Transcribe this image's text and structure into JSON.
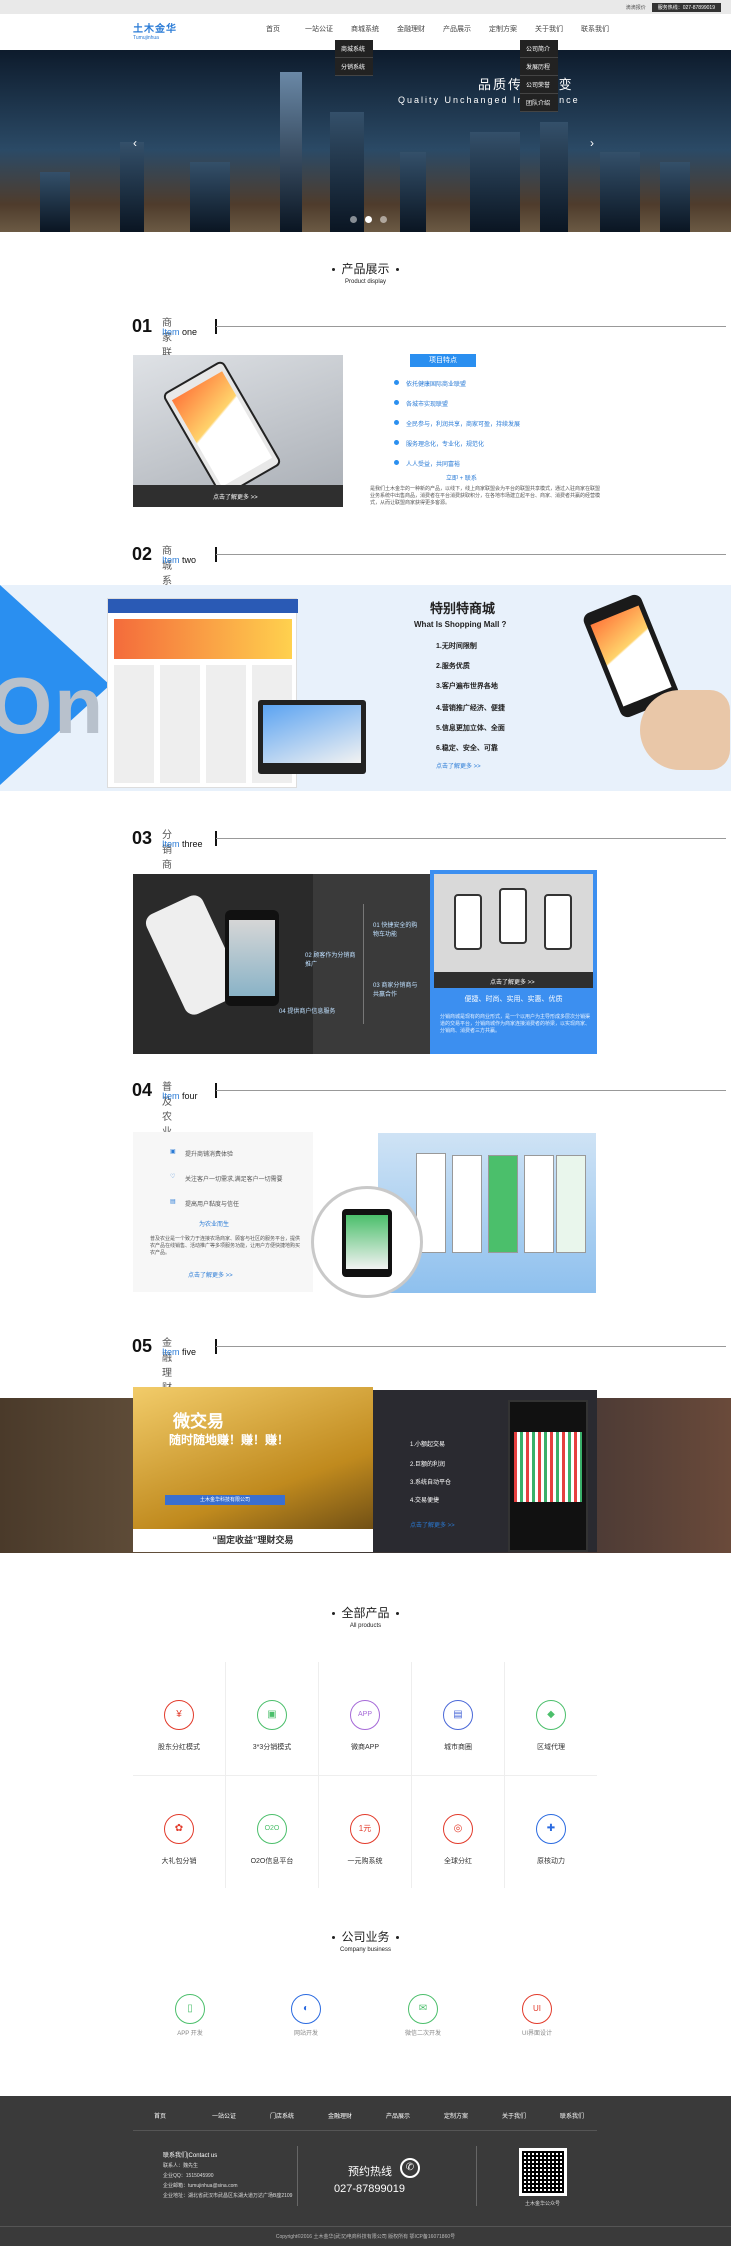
{
  "topbar": {
    "item1": "滴滴报价",
    "tel": "服务热线：027-87899019"
  },
  "header": {
    "logo_cn": "土木金华",
    "logo_en": "Tumujinhua",
    "nav": [
      "首页",
      "一站公证",
      "商城系统",
      "金融理财",
      "产品展示",
      "定制方案",
      "关于我们",
      "联系我们"
    ],
    "sub_mall": [
      "商城系统",
      "分销系统"
    ],
    "sub_about": [
      "公司简介",
      "发展历程",
      "公司荣誉",
      "团队介绍"
    ]
  },
  "hero": {
    "title": "品质传承 蜕变",
    "subtitle": "Quality Unchanged Inheritance",
    "prev": "‹",
    "next": "›"
  },
  "products": {
    "title_cn": "产品展示",
    "title_en": "Product display"
  },
  "item1": {
    "num": "01",
    "cn": "商家联盟",
    "en_a": "Item ",
    "en_b": "one",
    "badge": "项目特点",
    "features": [
      "依托健康国际商业联盟",
      "各城市实现联盟",
      "全民参与，利润共享，商家可盈，持续发展",
      "服务理念化，专业化，规范化",
      "人人受益，共同富裕"
    ],
    "more": "立即 + 联系",
    "cta": "点击了解更多 >>",
    "desc": "是我们土木金华的一种新的产品，以线下，线上商家联盟会为平台的联盟共享模式，通过入驻商家在联盟业务系统中出售商品，消费者在平台消费获取积分，在各地市场建立起平台、商家、消费者共赢的经营模式，从而让联盟商家获得更多客源。"
  },
  "item2": {
    "num": "02",
    "cn": "商城系统",
    "en_a": "Item ",
    "en_b": "two",
    "watermark": "One",
    "title_cn": "特别特商城",
    "title_en": "What Is Shopping Mall ?",
    "points": [
      "1.无时间限制",
      "2.服务优质",
      "3.客户遍布世界各地",
      "4.营销推广经济、便捷",
      "5.信息更加立体、全面",
      "6.稳定、安全、可靠"
    ],
    "cta": "点击了解更多 >>"
  },
  "item3": {
    "num": "03",
    "cn": "分销商城",
    "en_a": "Item ",
    "en_b": "three",
    "points": [
      "01 快捷安全的购物车功能",
      "02 顾客作为分销商推广",
      "03 商家分销商与共赢合作",
      "04 提供商户信息服务"
    ],
    "cta": "点击了解更多 >>",
    "keywords": "便捷、时尚、实用、实惠、优质",
    "desc": "分销商城是现有的商业形式，是一个以用户为主导形成多层次分销渠道的交易平台，分销商城作为商家连接消费者的桥梁，以实现商家、分销商、消费者三方共赢。"
  },
  "item4": {
    "num": "04",
    "cn": "普及农业",
    "en_a": "Item ",
    "en_b": "four",
    "points": [
      "提升商铺消费体验",
      "关注客户一切需求,满足客户一切需要",
      "提高用户黏度与信任"
    ],
    "more": "为农业而生",
    "cta": "点击了解更多 >>",
    "desc": "普及农业是一个致力于连接农场商家、顾客与社区的服务平台，提供农产品在线销售、活动推广等多项服务功能，让用户方便快捷地购买农产品。"
  },
  "item5": {
    "num": "05",
    "cn": "金融理财",
    "en_a": "Item ",
    "en_b": "five",
    "gold_title": "微交易",
    "gold_sub": "随时随地赚！赚！赚！",
    "gold_tag": "土木金华科技有限公司",
    "banner": "“固定收益”理财交易",
    "points": [
      "1.小额起交易",
      "2.巨额的利润",
      "3.系统自动平仓",
      "4.交易便捷"
    ],
    "cta": "点击了解更多 >>"
  },
  "all": {
    "title_cn": "全部产品",
    "title_en": "All products",
    "items": [
      {
        "label": "股东分红模式",
        "icon": "¥",
        "color": "#e23a2a"
      },
      {
        "label": "3*3分销模式",
        "icon": "▣",
        "color": "#4bbf6b"
      },
      {
        "label": "微商APP",
        "icon": "APP",
        "color": "#a66ad8"
      },
      {
        "label": "城市商圈",
        "icon": "▤",
        "color": "#4a68d8"
      },
      {
        "label": "区域代理",
        "icon": "◆",
        "color": "#4bbf6b"
      },
      {
        "label": "大礼包分销",
        "icon": "✿",
        "color": "#e23a2a"
      },
      {
        "label": "O2O信息平台",
        "icon": "O2O",
        "color": "#4bbf6b"
      },
      {
        "label": "一元购系统",
        "icon": "1元",
        "color": "#e23a2a"
      },
      {
        "label": "全球分红",
        "icon": "◎",
        "color": "#e23a2a"
      },
      {
        "label": "原核动力",
        "icon": "✚",
        "color": "#2a6ae0"
      }
    ]
  },
  "biz": {
    "title_cn": "公司业务",
    "title_en": "Company business",
    "items": [
      {
        "label": "APP 开发",
        "icon": "▯",
        "color": "#4bbf6b"
      },
      {
        "label": "网站开发",
        "icon": "◐",
        "color": "#2a6ae0"
      },
      {
        "label": "微信二次开发",
        "icon": "✉",
        "color": "#4bbf6b"
      },
      {
        "label": "UI界面设计",
        "icon": "UI",
        "color": "#e23a2a"
      }
    ]
  },
  "footer": {
    "nav": [
      "首页",
      "一站公证",
      "门店系统",
      "金融理财",
      "产品展示",
      "定制方案",
      "关于我们",
      "联系我们"
    ],
    "contact_title": "联系我们|Contact us",
    "contact": [
      "联系人：魏先生",
      "企业QQ：1515045990",
      "企业邮箱：tumujinhua@sina.com",
      "企业地址：湖北省武汉市武昌区东湖大道万达广场B座2109"
    ],
    "hot": "预约热线",
    "hotnum": "027-87899019",
    "qr_label": "土木金华公众号",
    "copy": "Copyright©2016 土木金华(武汉)电商科技有限公司 版权所有 鄂ICP备16071860号"
  }
}
